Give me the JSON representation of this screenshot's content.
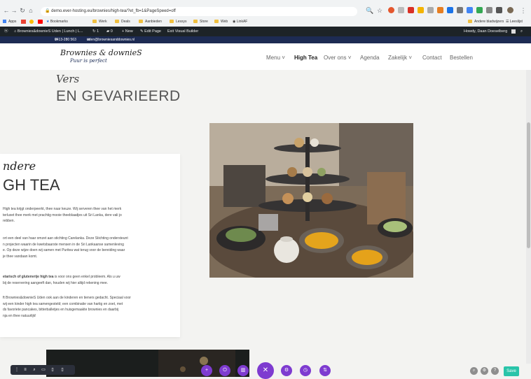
{
  "browser": {
    "url": "demo.ever-hosting.eu/brownies/high-tea/?et_fb=1&PageSpeed=off",
    "bookmarks": [
      "Apps",
      "Bookmarks",
      "Werk",
      "Deals",
      "Aanbieden",
      "Lessys",
      "Store",
      "Web",
      "LinkAF"
    ],
    "right_bookmarks": [
      "Andere bladwijzers",
      "Leeslijst"
    ]
  },
  "wp_admin": {
    "site_name": "Brownies&downieS Uden | Lunch | L...",
    "comments": "1",
    "updates": "0",
    "new_label": "New",
    "edit_page": "Edit Page",
    "exit_builder": "Exit Visual Builder",
    "howdy": "Howdy, Daan Doeselberg"
  },
  "topbar": {
    "phone": "0413-280 563",
    "email": "uden@browniesanddownies.nl"
  },
  "header": {
    "logo_main": "Brownies & downieS",
    "logo_tag": "Puur is perfect",
    "nav": [
      {
        "label": "Menu",
        "dropdown": true,
        "active": false
      },
      {
        "label": "High Tea",
        "dropdown": false,
        "active": true
      },
      {
        "label": "Over ons",
        "dropdown": true,
        "active": false
      },
      {
        "label": "Agenda",
        "dropdown": false,
        "active": false
      },
      {
        "label": "Zakelijk",
        "dropdown": true,
        "active": false
      },
      {
        "label": "Contact",
        "dropdown": false,
        "active": false
      },
      {
        "label": "Bestellen",
        "dropdown": false,
        "active": false
      }
    ]
  },
  "hero": {
    "script_heading": "Vers",
    "heading": "EN GEVARIEERD"
  },
  "card": {
    "script_heading": "ndere",
    "heading": "GH TEA",
    "p1": "High tea krijgt onderpeerkt, thee naar keuze. Wij serveren thee van het merk\nterluxet thee merk met prachtig mooie theeblaadjes uit Sri Lanka, dere vali jo\nrebben.",
    "p2": "ort een deel van haar omzet aan stichting Carelanka. Deze Stichting ondersteunt\nn projecten waarin de kwetsbaarste mensen in de Sri Lankaanse samenleving\ne. Op deze wijze doen wij samen met Puritea wat terug voor de bereiding waar\nje thee vandaan komt.",
    "p3_bold": "etarisch of glutenvrije high tea",
    "p3_rest": " is voor ons geen enkel probleem. Als u uw\nbij de reservering aangeeft dan, houden wij hier altijd rekening mee.",
    "p4": "ft Brownies&downieS Uden ook aan de kinderen en tieners gedacht. Speciaal voor\nwij een kinder high tea samengesteld; een combinatie van hartig en zoet, met\nds favoriete pancakes, bitterballetjes en huisgemaakte brownies en daarbij\nnja en thee natuurlijk!"
  },
  "builder": {
    "save_label": "Save"
  },
  "colors": {
    "wp_admin_bg": "#1d2327",
    "topbar_bg": "#1d2b53",
    "builder_purple": "#7e3bd0",
    "builder_dark": "#2b2f3a",
    "save_green": "#29c4a9"
  }
}
